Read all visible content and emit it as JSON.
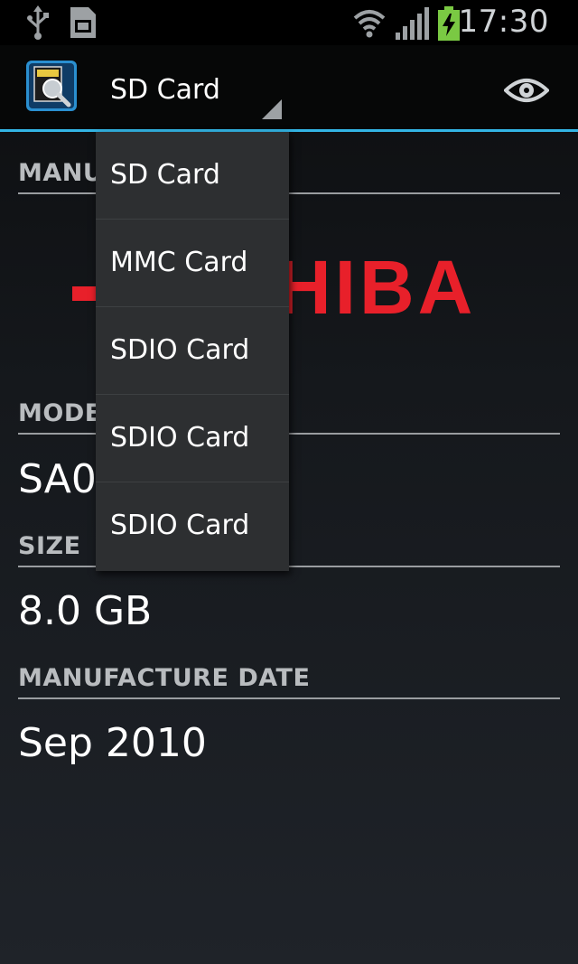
{
  "status_bar": {
    "time": "17:30",
    "icons": [
      "usb-icon",
      "sd-card-icon",
      "wifi-icon",
      "signal-icon",
      "battery-charging-icon"
    ]
  },
  "action_bar": {
    "app_icon": "sd-card-scanner-icon",
    "spinner_label": "SD Card",
    "action_icon": "eye-icon"
  },
  "dropdown": {
    "items": [
      "SD Card",
      "MMC Card",
      "SDIO Card",
      "SDIO Card",
      "SDIO Card"
    ]
  },
  "main": {
    "manufacturer": {
      "title": "MANU",
      "logo": "HIBA"
    },
    "model": {
      "title": "MODE",
      "value": "SA0"
    },
    "size": {
      "title": "SIZE",
      "value": "8.0 GB"
    },
    "manufacture_date": {
      "title": "MANUFACTURE DATE",
      "value": "Sep 2010"
    }
  },
  "colors": {
    "accent": "#33b5e5",
    "logo_red": "#e8202a",
    "battery_green": "#7ac943"
  }
}
